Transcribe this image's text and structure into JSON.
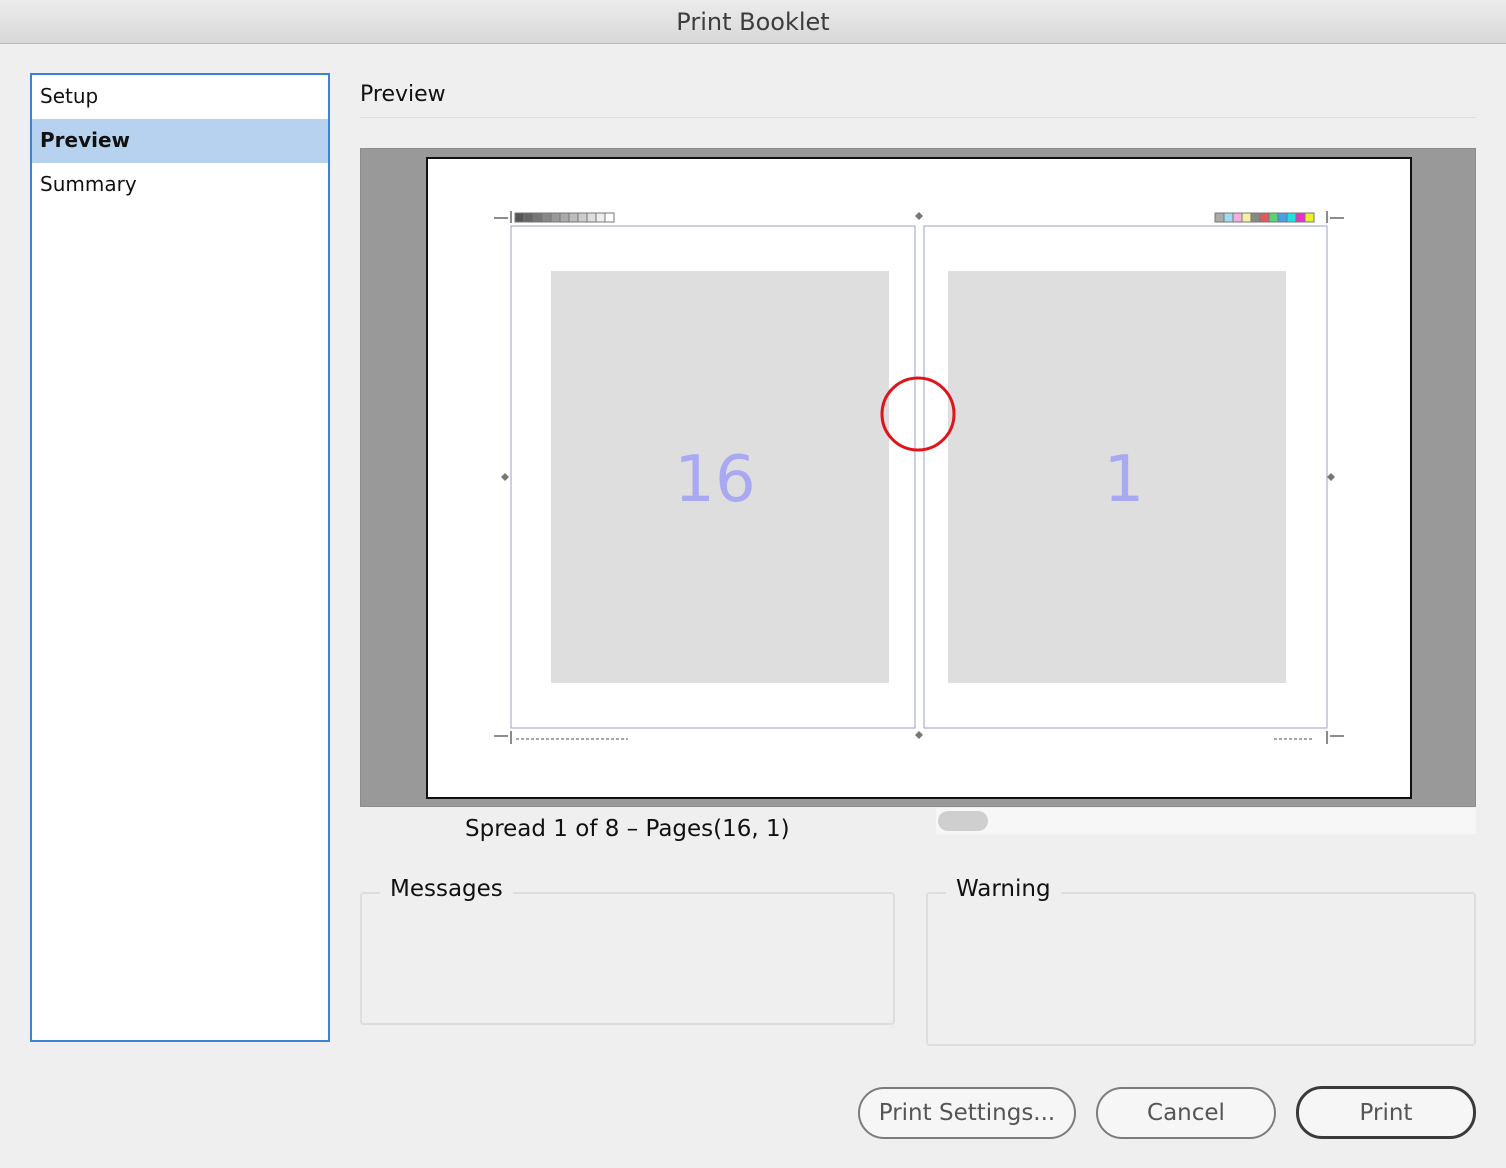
{
  "window": {
    "title": "Print Booklet"
  },
  "sidebar": {
    "items": [
      {
        "label": "Setup",
        "selected": false
      },
      {
        "label": "Preview",
        "selected": true
      },
      {
        "label": "Summary",
        "selected": false
      }
    ]
  },
  "main": {
    "section_title": "Preview",
    "preview": {
      "left_page": "16",
      "right_page": "1",
      "spread_label": "Spread 1 of 8 – Pages(16, 1)"
    },
    "messages_label": "Messages",
    "warning_label": "Warning"
  },
  "buttons": {
    "print_settings": "Print Settings...",
    "cancel": "Cancel",
    "print": "Print"
  },
  "colors": {
    "selection": "#b7d2ee",
    "sidebar_border": "#3b83d6",
    "page_number": "#a9a9f2",
    "highlight_circle": "#e0141b"
  }
}
